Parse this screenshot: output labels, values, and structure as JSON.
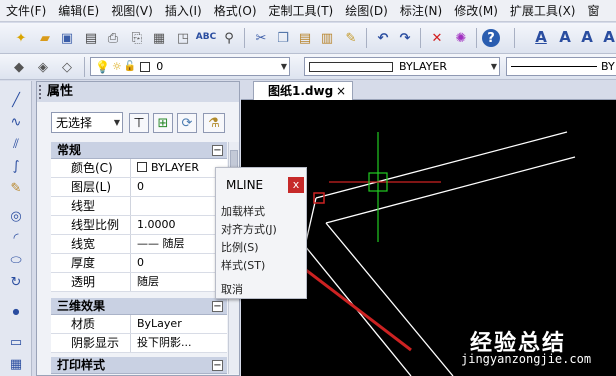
{
  "menu": [
    "文件(F)",
    "编辑(E)",
    "视图(V)",
    "插入(I)",
    "格式(O)",
    "定制工具(T)",
    "绘图(D)",
    "标注(N)",
    "修改(M)",
    "扩展工具(X)",
    "窗"
  ],
  "toolbar2": {
    "layer_value": "0",
    "linetype_value": "BYLAYER",
    "linetype2_value": "BY"
  },
  "properties": {
    "title": "属性",
    "selection": "无选择",
    "sections": {
      "general": "常规",
      "three_d": "三维效果",
      "print": "打印样式"
    },
    "general_rows": [
      {
        "key": "颜色(C)",
        "value": "BYLAYER"
      },
      {
        "key": "图层(L)",
        "value": "0"
      },
      {
        "key": "线型",
        "value": ""
      },
      {
        "key": "线型比例",
        "value": "1.0000"
      },
      {
        "key": "线宽",
        "value": "—— 随层"
      },
      {
        "key": "厚度",
        "value": "0"
      },
      {
        "key": "透明",
        "value": "随层"
      }
    ],
    "three_d_rows": [
      {
        "key": "材质",
        "value": "ByLayer"
      },
      {
        "key": "阴影显示",
        "value": "投下阴影..."
      }
    ]
  },
  "drawing_tab": {
    "label": "图纸1.dwg",
    "close": "×"
  },
  "mline_popup": {
    "title": "MLINE",
    "close": "x",
    "options": [
      "加载样式",
      "对齐方式(J)",
      "比例(S)",
      "样式(ST)",
      "取消"
    ]
  },
  "watermark": {
    "brand": "经验总结",
    "url": "jingyanzongjie.com"
  },
  "colors": {
    "canvas": "#000000",
    "accent_red": "#cc2222",
    "crosshair_green": "#22cc22"
  }
}
